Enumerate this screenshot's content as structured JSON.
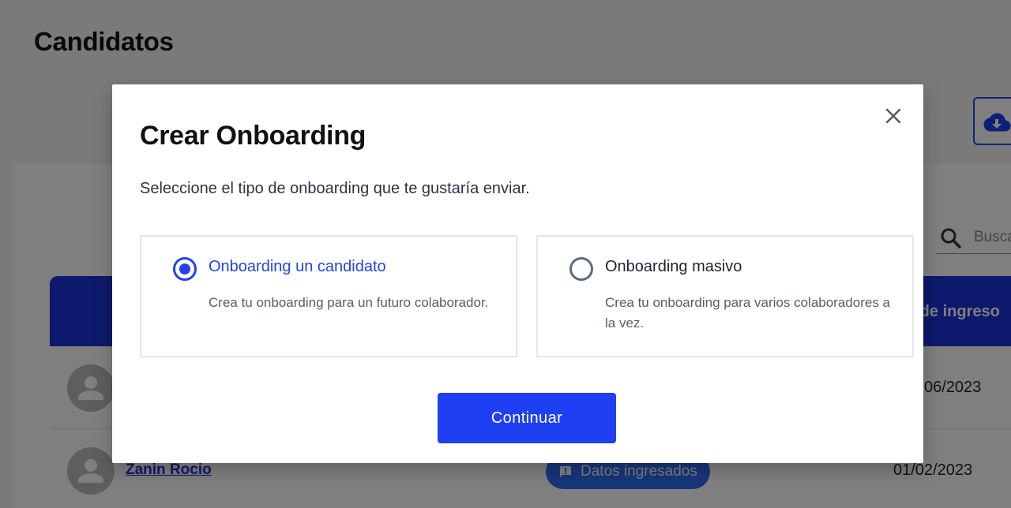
{
  "page": {
    "title": "Candidatos",
    "search_placeholder": "Busca",
    "table_header_date": "a de ingreso",
    "rows": [
      {
        "name": "",
        "status": "",
        "date": "06/2023"
      },
      {
        "name": "Zanin Rocio",
        "status": "Datos ingresados",
        "date": "01/02/2023"
      }
    ]
  },
  "modal": {
    "title": "Crear Onboarding",
    "subtitle": "Seleccione el tipo de onboarding que te gustaría enviar.",
    "options": [
      {
        "title": "Onboarding un candidato",
        "description": "Crea tu onboarding para un futuro colaborador.",
        "selected": true
      },
      {
        "title": "Onboarding masivo",
        "description": "Crea tu onboarding para varios colaboradores a la vez.",
        "selected": false
      }
    ],
    "continue_label": "Continuar"
  },
  "colors": {
    "primary": "#1f3ff2",
    "table_header": "#1a33d9",
    "status_pill": "#2f6df5",
    "overlay": "rgba(0,0,0,0.5)"
  },
  "icons": {
    "close": "close-icon",
    "download": "cloud-download-icon",
    "search": "search-icon",
    "avatar": "person-icon",
    "status": "feedback-icon"
  }
}
